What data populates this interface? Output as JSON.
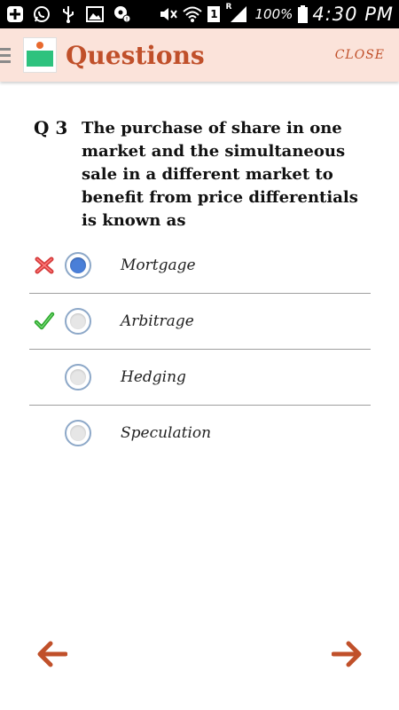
{
  "status_bar": {
    "battery_percent": "100%",
    "time": "4:30 PM",
    "left_icons": [
      "plus-icon",
      "whatsapp-icon",
      "usb-icon",
      "image-icon",
      "location-icon"
    ],
    "right_icons": [
      "mute-icon",
      "wifi-icon",
      "sim-icon",
      "signal-icon",
      "battery-icon"
    ],
    "sim_label": "1",
    "roaming_label": "R"
  },
  "header": {
    "title": "Questions",
    "close_label": "CLOSE",
    "accent_color": "#c0502a",
    "background_color": "#fbe3da"
  },
  "question": {
    "number": "Q 3",
    "text": "The purchase of share in one market and the simultaneous sale in a different market to benefit from price differentials is known as"
  },
  "options": [
    {
      "label": "Mortgage",
      "selected": true,
      "mark": "wrong"
    },
    {
      "label": "Arbitrage",
      "selected": false,
      "mark": "correct"
    },
    {
      "label": "Hedging",
      "selected": false,
      "mark": ""
    },
    {
      "label": "Speculation",
      "selected": false,
      "mark": ""
    }
  ],
  "navigation": {
    "prev_icon": "arrow-left-icon",
    "next_icon": "arrow-right-icon",
    "arrow_color": "#c0502a"
  }
}
